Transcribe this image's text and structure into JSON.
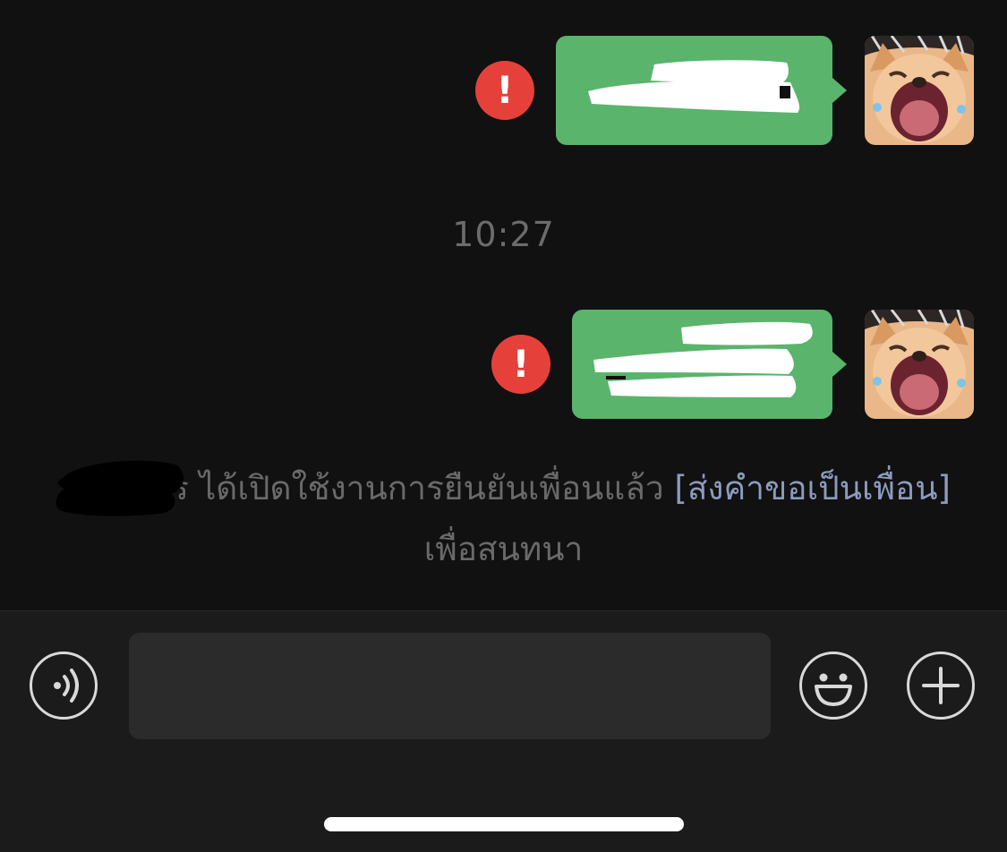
{
  "messages": [
    {
      "status_icon": "!",
      "sender_avatar": "shiba-crying-sticker",
      "text": ""
    },
    {
      "status_icon": "!",
      "sender_avatar": "shiba-crying-sticker",
      "text": ""
    }
  ],
  "timestamp": "10:27",
  "system_notice": {
    "name_suffix": "ร ",
    "text_before_link": "ได้เปิดใช้งานการยืนยันเพื่อนแล้ว ",
    "link_text": "[ส่งคำขอเป็นเพื่อน]",
    "text_after_link": " เพื่อสนทนา"
  },
  "input_bar": {
    "voice_icon": "voice-icon",
    "message_placeholder": "",
    "emoji_icon": "emoji-icon",
    "add_icon": "plus-icon"
  },
  "colors": {
    "background": "#111111",
    "bubble_green": "#5ab46c",
    "error_red": "#e5413a",
    "link_blue": "#8d9bbd"
  }
}
